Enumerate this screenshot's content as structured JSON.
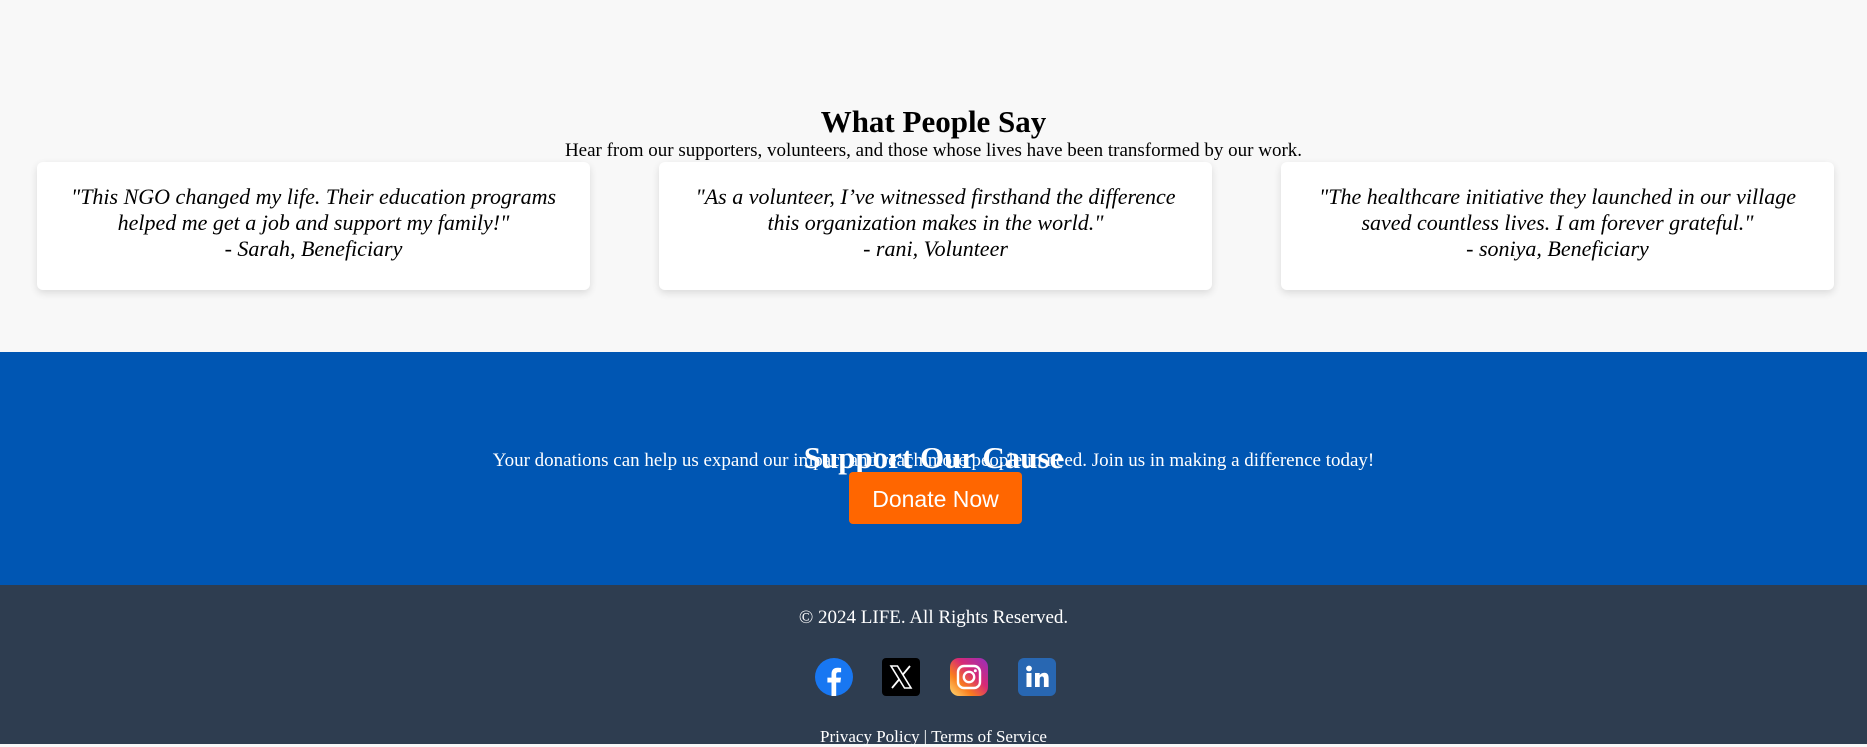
{
  "testimonials": {
    "title": "What People Say",
    "subtitle": "Hear from our supporters, volunteers, and those whose lives have been transformed by our work.",
    "cards": [
      {
        "quote": "\"This NGO changed my life. Their education programs helped me get a job and support my family!\"",
        "author": "- Sarah, Beneficiary"
      },
      {
        "quote": "\"As a volunteer, I’ve witnessed firsthand the difference this organization makes in the world.\"",
        "author": "- rani, Volunteer"
      },
      {
        "quote": "\"The healthcare initiative they launched in our village saved countless lives. I am forever grateful.\"",
        "author": "- soniya, Beneficiary"
      }
    ]
  },
  "support": {
    "title": "Support Our Cause",
    "subtitle": "Your donations can help us expand our impact and reach more people in need. Join us in making a difference today!",
    "donate_label": "Donate Now"
  },
  "footer": {
    "copyright": "© 2024 LIFE. All Rights Reserved.",
    "social_icons": [
      "facebook-icon",
      "x-icon",
      "instagram-icon",
      "linkedin-icon"
    ],
    "privacy_label": "Privacy Policy",
    "separator": "|",
    "terms_label": "Terms of Service"
  },
  "colors": {
    "background": "#f8f8f8",
    "support_bg": "#0056b3",
    "donate_button": "#ff6600",
    "footer_bg": "#2e3d50"
  }
}
